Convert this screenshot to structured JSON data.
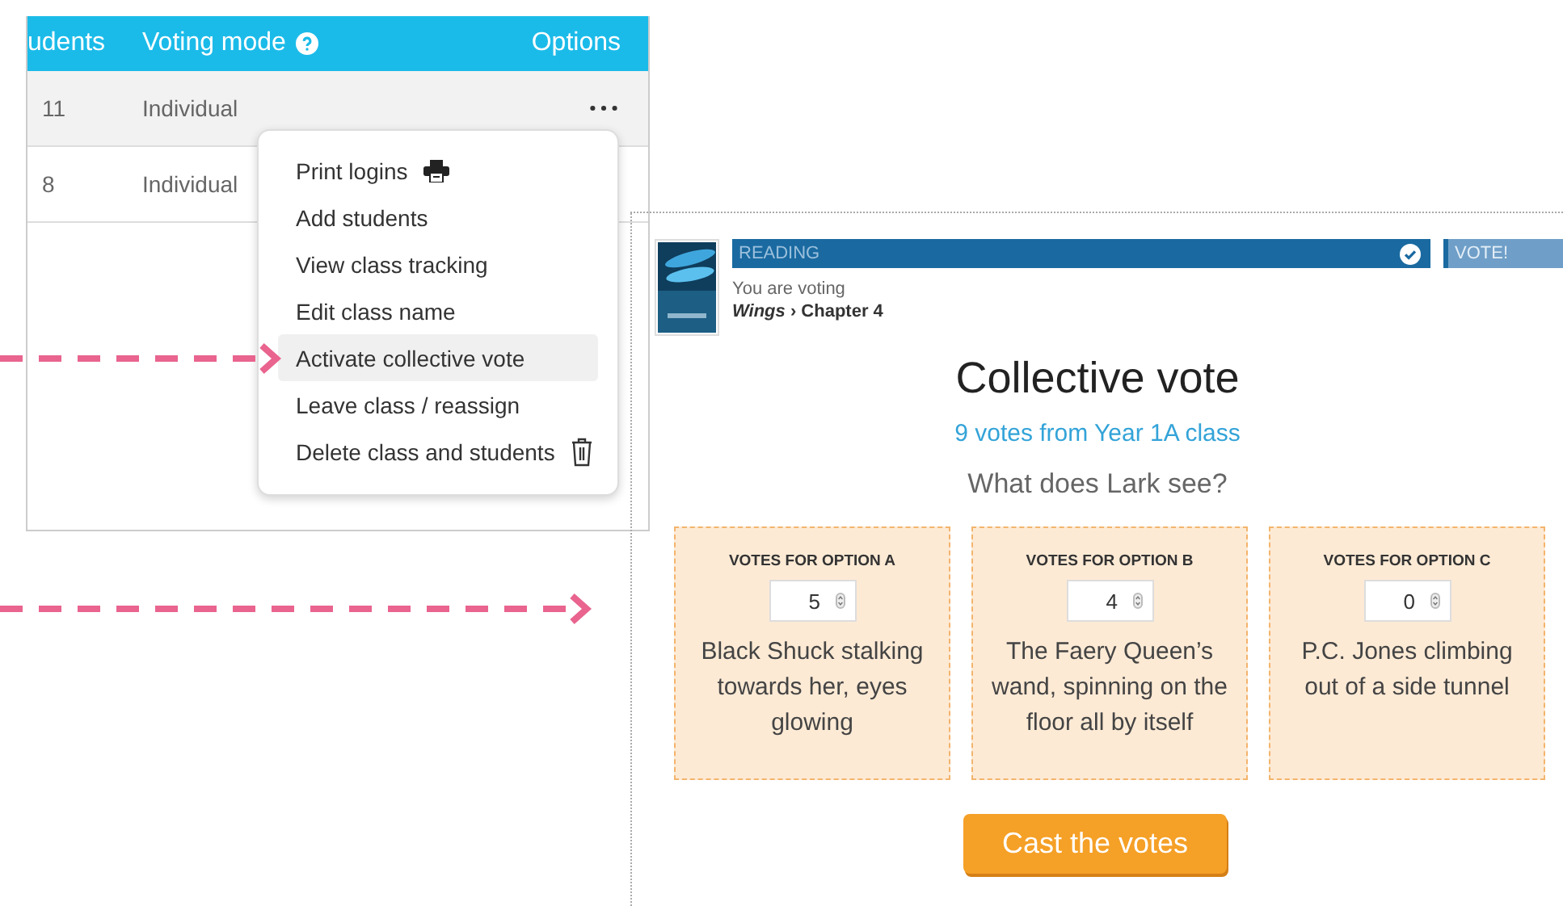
{
  "class_table": {
    "columns": [
      {
        "label": "udents",
        "help": false
      },
      {
        "label": "Voting mode",
        "help": true
      },
      {
        "label": "Options",
        "help": false
      }
    ],
    "rows": [
      {
        "students": "11",
        "voting_mode": "Individual",
        "selected": true
      },
      {
        "students": "8",
        "voting_mode": "Individual",
        "selected": false
      }
    ]
  },
  "options_menu": {
    "items": [
      {
        "label": "Print logins",
        "kind": "printer",
        "highlighted": false
      },
      {
        "label": "Add students",
        "kind": "plain",
        "highlighted": false
      },
      {
        "label": "View class tracking",
        "kind": "plain",
        "highlighted": false
      },
      {
        "label": "Edit class name",
        "kind": "plain",
        "highlighted": false
      },
      {
        "label": "Activate collective vote",
        "kind": "plain",
        "highlighted": true
      },
      {
        "label": "Leave class / reassign",
        "kind": "plain",
        "highlighted": false
      },
      {
        "label": "Delete class and students",
        "kind": "trash",
        "highlighted": false
      }
    ]
  },
  "vote_panel": {
    "steps": [
      {
        "label": "READING",
        "done": true
      },
      {
        "label": "VOTE!",
        "done": false
      }
    ],
    "status": "You are voting",
    "book": "*Wings* › Chapter 4",
    "title": "Collective vote",
    "votes_summary": "9 votes from Year 1A class",
    "question": "What does Lark see?",
    "options": [
      {
        "label": "VOTES FOR OPTION A",
        "votes": "5",
        "text": "Black Shuck stalking towards her, eyes glowing"
      },
      {
        "label": "VOTES FOR OPTION B",
        "votes": "4",
        "text": "The Faery Queen’s wand, spinning on the floor all by itself"
      },
      {
        "label": "VOTES FOR OPTION C",
        "votes": "0",
        "text": "P.C. Jones climbing out of a side tunnel"
      }
    ],
    "submit": "Cast the votes"
  }
}
